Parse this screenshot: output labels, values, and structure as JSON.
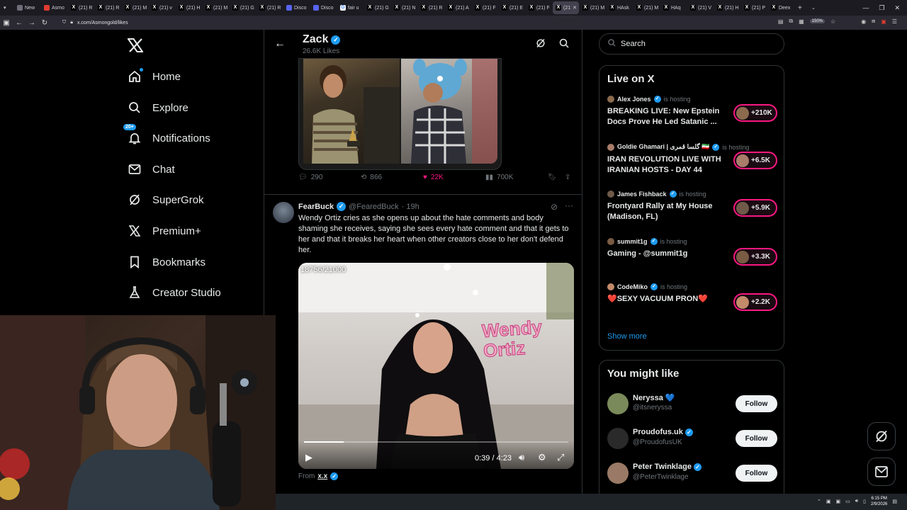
{
  "browser": {
    "tabs": [
      {
        "label": "New",
        "color": "#6f6f7a",
        "glyph": ""
      },
      {
        "label": "Asmo",
        "color": "#e03c31",
        "glyph": ""
      },
      {
        "label": "(21) R",
        "color": "#000000",
        "glyph": "X"
      },
      {
        "label": "(21) R",
        "color": "#000000",
        "glyph": "X"
      },
      {
        "label": "(21) M",
        "color": "#000000",
        "glyph": "X"
      },
      {
        "label": "(21) v",
        "color": "#000000",
        "glyph": "X"
      },
      {
        "label": "(21) H",
        "color": "#000000",
        "glyph": "X"
      },
      {
        "label": "(21) M",
        "color": "#000000",
        "glyph": "X"
      },
      {
        "label": "(21) G",
        "color": "#000000",
        "glyph": "X"
      },
      {
        "label": "(21) R",
        "color": "#000000",
        "glyph": "X"
      },
      {
        "label": "Disco",
        "color": "#5865f2",
        "glyph": ""
      },
      {
        "label": "Disco",
        "color": "#5865f2",
        "glyph": ""
      },
      {
        "label": "fair u",
        "color": "#ffffff",
        "glyph": "G"
      },
      {
        "label": "(21) G",
        "color": "#000000",
        "glyph": "X"
      },
      {
        "label": "(21) N",
        "color": "#000000",
        "glyph": "X"
      },
      {
        "label": "(21) R",
        "color": "#000000",
        "glyph": "X"
      },
      {
        "label": "(21) A",
        "color": "#000000",
        "glyph": "X"
      },
      {
        "label": "(21) F",
        "color": "#000000",
        "glyph": "X"
      },
      {
        "label": "(21) E",
        "color": "#000000",
        "glyph": "X"
      },
      {
        "label": "(21) F",
        "color": "#000000",
        "glyph": "X"
      },
      {
        "label": "(21",
        "color": "#000000",
        "glyph": "X",
        "active": true
      },
      {
        "label": "(21) M",
        "color": "#000000",
        "glyph": "X"
      },
      {
        "label": "HAsk",
        "color": "#000000",
        "glyph": "X"
      },
      {
        "label": "(21) M",
        "color": "#000000",
        "glyph": "X"
      },
      {
        "label": "HAq",
        "color": "#000000",
        "glyph": "X"
      },
      {
        "label": "(21) V",
        "color": "#000000",
        "glyph": "X"
      },
      {
        "label": "(21) H",
        "color": "#000000",
        "glyph": "X"
      },
      {
        "label": "(21) P",
        "color": "#000000",
        "glyph": "X"
      },
      {
        "label": "Deex",
        "color": "#000000",
        "glyph": "X"
      }
    ],
    "url": "x.com/Asmongold/likes",
    "zoom": "150%"
  },
  "leftnav": {
    "items": [
      {
        "label": "Home",
        "icon": "home-icon"
      },
      {
        "label": "Explore",
        "icon": "search-icon"
      },
      {
        "label": "Notifications",
        "icon": "bell-icon",
        "badge": "20+"
      },
      {
        "label": "Chat",
        "icon": "mail-icon"
      },
      {
        "label": "SuperGrok",
        "icon": "grok-icon"
      },
      {
        "label": "Premium+",
        "icon": "x-logo-icon"
      },
      {
        "label": "Bookmarks",
        "icon": "bookmark-icon"
      },
      {
        "label": "Creator Studio",
        "icon": "flask-icon"
      }
    ]
  },
  "profile": {
    "name": "Zack",
    "likes": "26.6K Likes"
  },
  "tweet1": {
    "replies": "290",
    "reposts": "866",
    "likes": "22K",
    "views": "700K",
    "like_color": "#f91880"
  },
  "tweet2": {
    "name": "FearBuck",
    "handle": "@FearedBuck",
    "time": "· 19h",
    "text": "Wendy Ortiz cries as she opens up about the hate comments and body shaming she receives, saying she sees every hate comment and that it gets to her and that it breaks her heart when other creators close to her don't defend her.",
    "video_counter": "18756/21000",
    "video_sign": "Wendy Ortiz",
    "time_current": "0:39",
    "time_total": "4:23",
    "progress_fraction": 0.15,
    "from_label": "From",
    "from_name": "x.x"
  },
  "search": {
    "placeholder": "Search"
  },
  "live": {
    "title": "Live on X",
    "hosting_label": "is hosting",
    "items": [
      {
        "host": "Alex Jones",
        "title": "BREAKING LIVE: New Epstein Docs Prove He Led Satanic ...",
        "count": "+210K"
      },
      {
        "host": "Goldie Ghamari | گلسا قمری 🇮🇷",
        "title": "IRAN REVOLUTION LIVE WITH IRANIAN HOSTS - DAY 44",
        "count": "+6.5K"
      },
      {
        "host": "James Fishback",
        "title": "Frontyard Rally at My House (Madison, FL)",
        "count": "+5.9K"
      },
      {
        "host": "summit1g",
        "title": "Gaming - @summit1g",
        "count": "+3.3K"
      },
      {
        "host": "CodeMiko",
        "title": "❤️SEXY VACUUM PRON❤️",
        "count": "+2.2K"
      }
    ],
    "show_more": "Show more",
    "pill_color": "#f91880"
  },
  "suggest": {
    "title": "You might like",
    "follow_label": "Follow",
    "items": [
      {
        "name": "Neryssa 💙",
        "handle": "@itsneryssa"
      },
      {
        "name": "Proudofus.uk",
        "handle": "@ProudofusUK"
      },
      {
        "name": "Peter Twinklage",
        "handle": "@PeterTwinklage"
      }
    ]
  },
  "taskbar": {
    "time": "6:15 PM",
    "date": "2/9/2026"
  },
  "colors": {
    "accent": "#1d9bf0",
    "background": "#000000",
    "border": "#2f3336"
  }
}
